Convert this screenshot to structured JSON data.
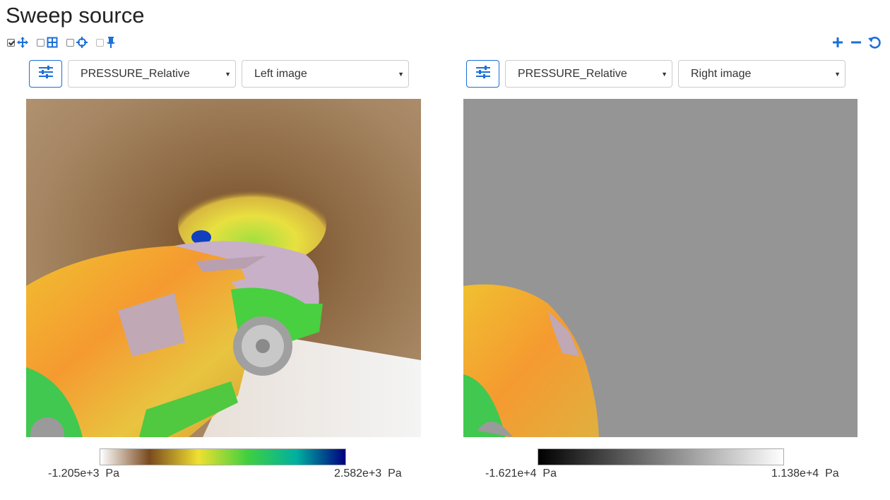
{
  "title": "Sweep source",
  "toolbar": {
    "tools": [
      {
        "name": "pan",
        "checked": true,
        "icon": "move-arrows-icon"
      },
      {
        "name": "grid",
        "checked": false,
        "icon": "grid-icon"
      },
      {
        "name": "probe",
        "checked": false,
        "icon": "crosshair-icon"
      },
      {
        "name": "pin",
        "checked": false,
        "icon": "pin-icon"
      }
    ],
    "right_actions": [
      {
        "name": "zoom-in",
        "icon": "plus-icon"
      },
      {
        "name": "zoom-out",
        "icon": "minus-icon"
      },
      {
        "name": "reset",
        "icon": "undo-icon"
      }
    ],
    "accent": "#1a6fd8"
  },
  "left": {
    "field": "PRESSURE_Relative",
    "image": "Left image",
    "colorbar": {
      "min_label": "-1.205e+3",
      "max_label": "2.582e+3",
      "unit": "Pa",
      "colors": [
        "#ffffff",
        "#7a4a1e",
        "#f0e030",
        "#40d040",
        "#00b0a0",
        "#000080"
      ]
    }
  },
  "right": {
    "field": "PRESSURE_Relative",
    "image": "Right image",
    "colorbar": {
      "min_label": "-1.621e+4",
      "max_label": "1.138e+4",
      "unit": "Pa",
      "colors": [
        "#000000",
        "#ffffff"
      ]
    }
  }
}
